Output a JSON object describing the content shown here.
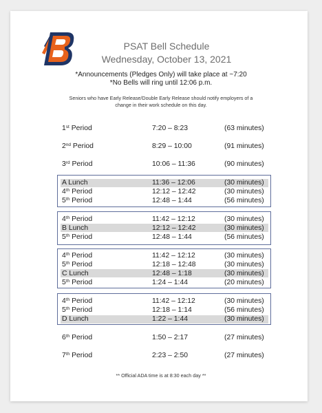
{
  "header": {
    "title": "PSAT Bell Schedule",
    "date": "Wednesday, October 13, 2021",
    "logo_letter": "B"
  },
  "notices": {
    "announcements": "*Announcements (Pledges Only) will take place at ~7:20",
    "no_bells": "*No Bells will ring until 12:06 p.m.",
    "seniors_line1": "Seniors who have Early Release/Double Early Release should notify employers of a",
    "seniors_line2": "change in their work schedule on this day."
  },
  "schedule": {
    "p1": {
      "num": "1",
      "sup": "st",
      "label": "Period",
      "time": "7:20 – 8:23",
      "duration": "(63 minutes)"
    },
    "p2": {
      "num": "2",
      "sup": "nd",
      "label": "Period",
      "time": "8:29 – 10:00",
      "duration": "(91 minutes)"
    },
    "p3": {
      "num": "3",
      "sup": "rd",
      "label": "Period",
      "time": "10:06 – 11:36",
      "duration": "(90 minutes)"
    },
    "a_lunch": {
      "label": "A Lunch",
      "time": "11:36 – 12:06",
      "duration": "(30 minutes)"
    },
    "a_p4": {
      "num": "4",
      "sup": "th",
      "label": "Period",
      "time": "12:12 – 12:42",
      "duration": "(30 minutes)"
    },
    "a_p5": {
      "num": "5",
      "sup": "th",
      "label": "Period",
      "time": "12:48 – 1:44",
      "duration": "(56 minutes)"
    },
    "b_p4": {
      "num": "4",
      "sup": "th",
      "label": "Period",
      "time": "11:42 – 12:12",
      "duration": "(30 minutes)"
    },
    "b_lunch": {
      "label": "B Lunch",
      "time": "12:12 – 12:42",
      "duration": "(30 minutes)"
    },
    "b_p5": {
      "num": "5",
      "sup": "th",
      "label": "Period",
      "time": "12:48 – 1:44",
      "duration": "(56 minutes)"
    },
    "c_p4": {
      "num": "4",
      "sup": "th",
      "label": "Period",
      "time": "11:42 – 12:12",
      "duration": "(30 minutes)"
    },
    "c_p5a": {
      "num": "5",
      "sup": "th",
      "label": "Period",
      "time": "12:18 – 12:48",
      "duration": "(30 minutes)"
    },
    "c_lunch": {
      "label": "C Lunch",
      "time": "12:48 – 1:18",
      "duration": "(30 minutes)"
    },
    "c_p5b": {
      "num": "5",
      "sup": "th",
      "label": "Period",
      "time": "1:24 – 1:44",
      "duration": "(20 minutes)"
    },
    "d_p4": {
      "num": "4",
      "sup": "th",
      "label": "Period",
      "time": "11:42 – 12:12",
      "duration": "(30 minutes)"
    },
    "d_p5": {
      "num": "5",
      "sup": "th",
      "label": "Period",
      "time": "12:18 – 1:14",
      "duration": "(56 minutes)"
    },
    "d_lunch": {
      "label": "D Lunch",
      "time": "1:22 – 1:44",
      "duration": "(30 minutes)"
    },
    "p6": {
      "num": "6",
      "sup": "th",
      "label": "Period",
      "time": "1:50 – 2:17",
      "duration": "(27 minutes)"
    },
    "p7": {
      "num": "7",
      "sup": "th",
      "label": "Period",
      "time": "2:23 – 2:50",
      "duration": "(27 minutes)"
    }
  },
  "footer": "** Official ADA time is at 8:30 each day **",
  "colors": {
    "box_border": "#5d6c9a",
    "lunch_highlight": "#d9d9d9",
    "logo_orange": "#e8621c",
    "logo_navy": "#1f3566"
  }
}
